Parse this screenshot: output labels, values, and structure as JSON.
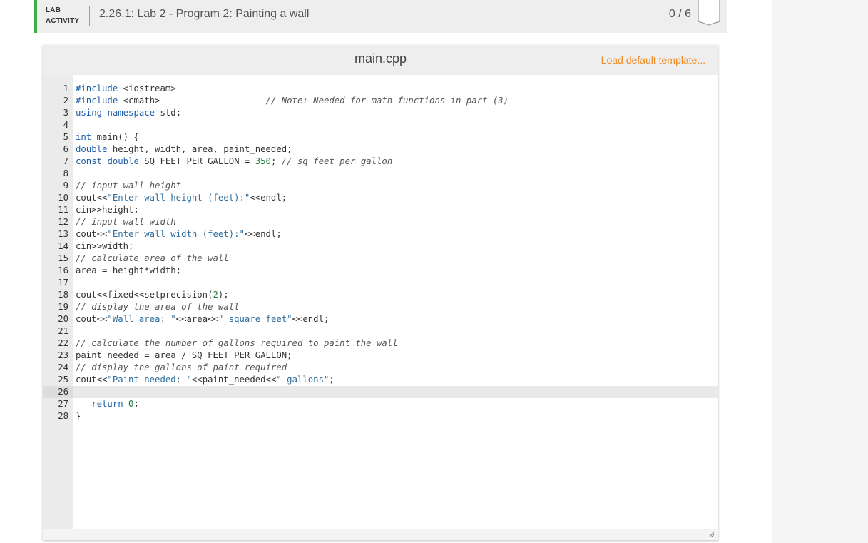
{
  "header": {
    "lab_label_line1": "LAB",
    "lab_label_line2": "ACTIVITY",
    "title": "2.26.1: Lab 2 - Program 2: Painting a wall",
    "score": "0 / 6"
  },
  "editor": {
    "filename": "main.cpp",
    "load_template_label": "Load default template...",
    "active_line": 26,
    "lines": [
      {
        "n": "1",
        "t": "#include <iostream>"
      },
      {
        "n": "2",
        "t": "#include <cmath>                    // Note: Needed for math functions in part (3)"
      },
      {
        "n": "3",
        "t": "using namespace std;"
      },
      {
        "n": "4",
        "t": ""
      },
      {
        "n": "5",
        "t": "int main() {"
      },
      {
        "n": "6",
        "t": "double height, width, area, paint_needed;"
      },
      {
        "n": "7",
        "t": "const double SQ_FEET_PER_GALLON = 350; // sq feet per gallon"
      },
      {
        "n": "8",
        "t": ""
      },
      {
        "n": "9",
        "t": "// input wall height"
      },
      {
        "n": "10",
        "t": "cout<<\"Enter wall height (feet):\"<<endl;"
      },
      {
        "n": "11",
        "t": "cin>>height;"
      },
      {
        "n": "12",
        "t": "// input wall width"
      },
      {
        "n": "13",
        "t": "cout<<\"Enter wall width (feet):\"<<endl;"
      },
      {
        "n": "14",
        "t": "cin>>width;"
      },
      {
        "n": "15",
        "t": "// calculate area of the wall"
      },
      {
        "n": "16",
        "t": "area = height*width;"
      },
      {
        "n": "17",
        "t": ""
      },
      {
        "n": "18",
        "t": "cout<<fixed<<setprecision(2);"
      },
      {
        "n": "19",
        "t": "// display the area of the wall"
      },
      {
        "n": "20",
        "t": "cout<<\"Wall area: \"<<area<<\" square feet\"<<endl;"
      },
      {
        "n": "21",
        "t": ""
      },
      {
        "n": "22",
        "t": "// calculate the number of gallons required to paint the wall"
      },
      {
        "n": "23",
        "t": "paint_needed = area / SQ_FEET_PER_GALLON;"
      },
      {
        "n": "24",
        "t": "// display the gallons of paint required"
      },
      {
        "n": "25",
        "t": "cout<<\"Paint needed: \"<<paint_needed<<\" gallons\";"
      },
      {
        "n": "26",
        "t": ""
      },
      {
        "n": "27",
        "t": "   return 0;"
      },
      {
        "n": "28",
        "t": "}"
      }
    ]
  },
  "colors": {
    "accent_green": "#3fae49",
    "link_orange": "#f08a24"
  }
}
